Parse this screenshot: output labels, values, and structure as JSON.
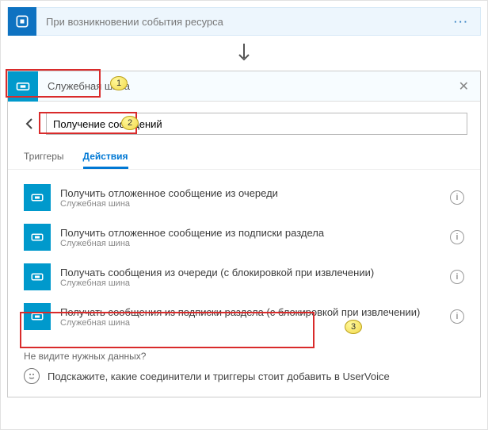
{
  "trigger": {
    "title": "При возникновении события ресурса",
    "more_glyph": "···"
  },
  "step": {
    "title": "Служебная шина",
    "close_glyph": "✕"
  },
  "search": {
    "value": "Получение сообщений"
  },
  "tabs": {
    "triggers": "Триггеры",
    "actions": "Действия"
  },
  "actions": [
    {
      "title": "Получить отложенное сообщение из очереди",
      "sub": "Служебная шина"
    },
    {
      "title": "Получить отложенное сообщение из подписки раздела",
      "sub": "Служебная шина"
    },
    {
      "title": "Получать сообщения из очереди (с блокировкой при извлечении)",
      "sub": "Служебная шина"
    },
    {
      "title": "Получать сообщения из подписки раздела (с блокировкой при извлечении)",
      "sub": "Служебная шина"
    }
  ],
  "footer": {
    "question": "Не видите нужных данных?",
    "suggestion": "Подскажите, какие соединители и триггеры стоит добавить в UserVoice"
  },
  "annotations": {
    "b1": "1",
    "b2": "2",
    "b3": "3"
  }
}
